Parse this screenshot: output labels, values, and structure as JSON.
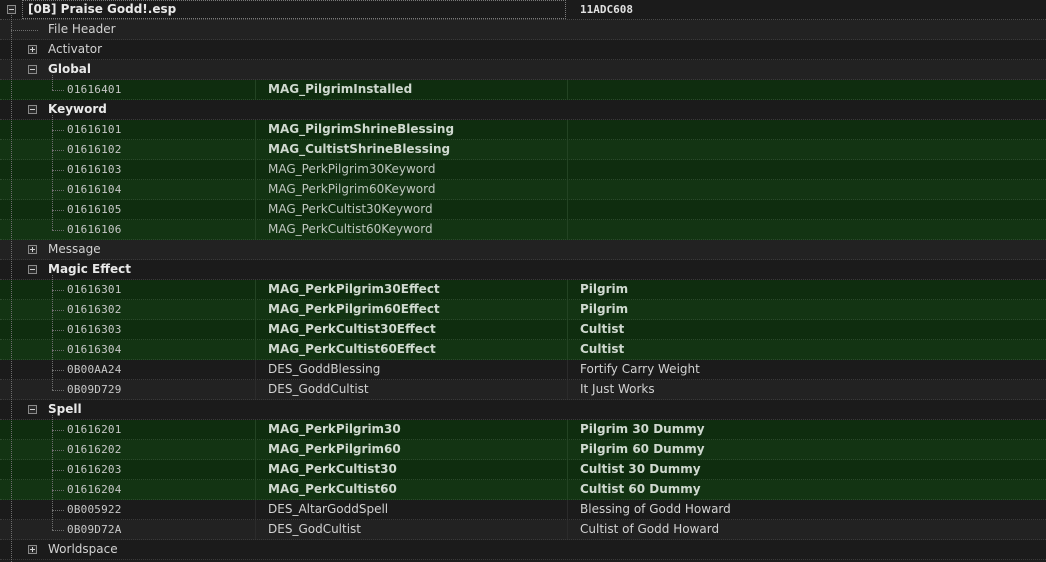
{
  "root": {
    "name": "[0B] Praise Godd!.esp",
    "id": "11ADC608"
  },
  "groups": {
    "file_header": "File Header",
    "activator": "Activator",
    "global": "Global",
    "keyword": "Keyword",
    "message": "Message",
    "magic_effect": "Magic Effect",
    "spell": "Spell",
    "worldspace": "Worldspace"
  },
  "global": [
    {
      "form_id": "01616401",
      "editor_id": "MAG_PilgrimInstalled",
      "name": ""
    }
  ],
  "keyword": [
    {
      "form_id": "01616101",
      "editor_id": "MAG_PilgrimShrineBlessing",
      "name": ""
    },
    {
      "form_id": "01616102",
      "editor_id": "MAG_CultistShrineBlessing",
      "name": ""
    },
    {
      "form_id": "01616103",
      "editor_id": "MAG_PerkPilgrim30Keyword",
      "name": ""
    },
    {
      "form_id": "01616104",
      "editor_id": "MAG_PerkPilgrim60Keyword",
      "name": ""
    },
    {
      "form_id": "01616105",
      "editor_id": "MAG_PerkCultist30Keyword",
      "name": ""
    },
    {
      "form_id": "01616106",
      "editor_id": "MAG_PerkCultist60Keyword",
      "name": ""
    }
  ],
  "magic_effect": [
    {
      "form_id": "01616301",
      "editor_id": "MAG_PerkPilgrim30Effect",
      "name": "Pilgrim"
    },
    {
      "form_id": "01616302",
      "editor_id": "MAG_PerkPilgrim60Effect",
      "name": "Pilgrim"
    },
    {
      "form_id": "01616303",
      "editor_id": "MAG_PerkCultist30Effect",
      "name": "Cultist"
    },
    {
      "form_id": "01616304",
      "editor_id": "MAG_PerkCultist60Effect",
      "name": "Cultist"
    },
    {
      "form_id": "0B00AA24",
      "editor_id": "DES_GoddBlessing",
      "name": "Fortify Carry Weight"
    },
    {
      "form_id": "0B09D729",
      "editor_id": "DES_GoddCultist",
      "name": "It Just Works"
    }
  ],
  "spell": [
    {
      "form_id": "01616201",
      "editor_id": "MAG_PerkPilgrim30",
      "name": "Pilgrim 30 Dummy"
    },
    {
      "form_id": "01616202",
      "editor_id": "MAG_PerkPilgrim60",
      "name": "Pilgrim 60 Dummy"
    },
    {
      "form_id": "01616203",
      "editor_id": "MAG_PerkCultist30",
      "name": "Cultist 30 Dummy"
    },
    {
      "form_id": "01616204",
      "editor_id": "MAG_PerkCultist60",
      "name": "Cultist 60 Dummy"
    },
    {
      "form_id": "0B005922",
      "editor_id": "DES_AltarGoddSpell",
      "name": "Blessing of Godd Howard"
    },
    {
      "form_id": "0B09D72A",
      "editor_id": "DES_GodCultist",
      "name": "Cultist of Godd Howard"
    }
  ],
  "colors": {
    "background": "#1e1e1e",
    "override_row": "#0f2d0f",
    "text": "#d2d2d2"
  }
}
